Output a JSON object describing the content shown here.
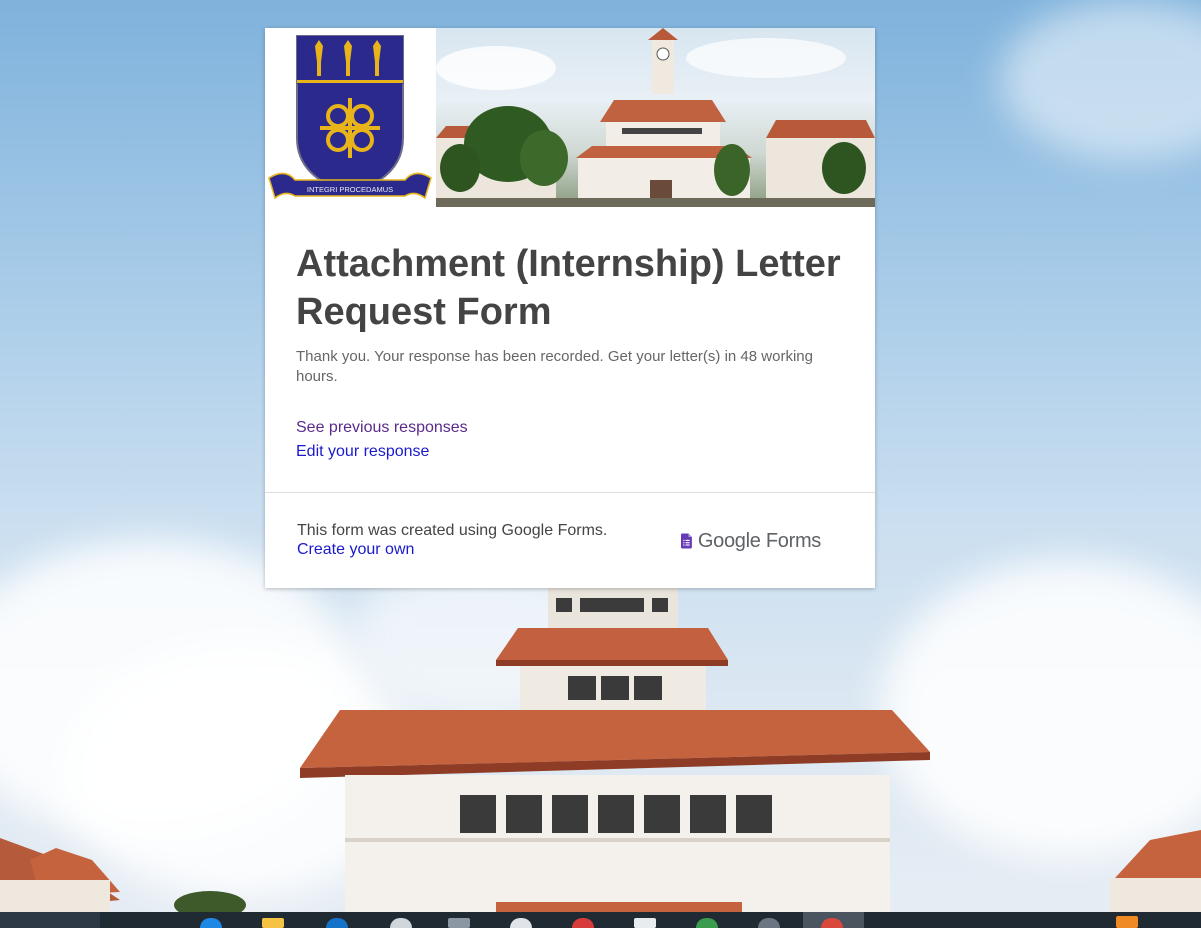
{
  "form": {
    "title": "Attachment (Internship) Letter Request Form",
    "confirmation_message": "Thank you. Your response has been recorded. Get your letter(s) in 48 working  hours.",
    "links": {
      "previous_responses": "See previous responses",
      "edit_response": "Edit your response"
    },
    "banner": {
      "crest_motto": "INTEGRI PROCEDAMUS"
    }
  },
  "footer": {
    "created_with": "This form was created using Google Forms.",
    "create_own": "Create your own",
    "logo_text": "Google Forms"
  },
  "colors": {
    "visited_link": "#5b2b8a",
    "link": "#1a1acc",
    "title_text": "#444444",
    "crest_blue": "#2b2a8c",
    "crest_gold": "#e8b41a",
    "forms_purple": "#673ab7"
  }
}
